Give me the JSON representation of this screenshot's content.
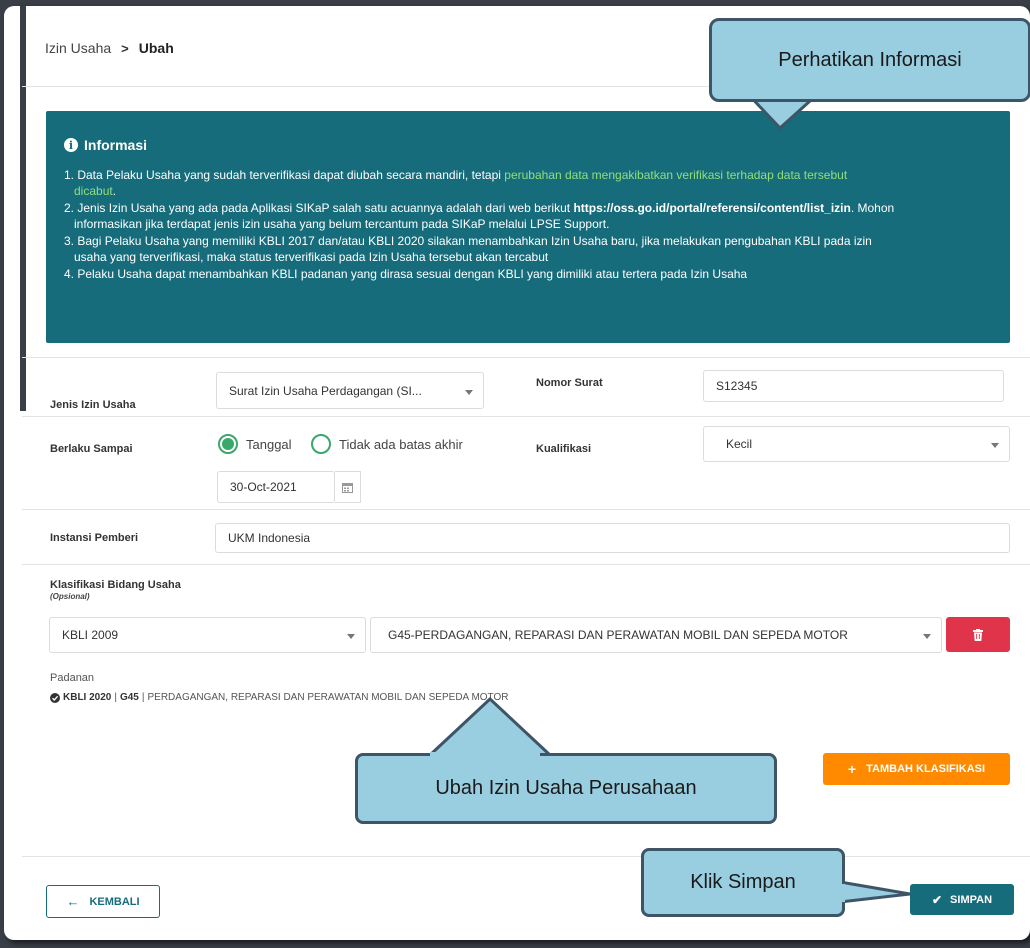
{
  "breadcrumb": {
    "parent": "Izin Usaha",
    "separator": ">",
    "current": "Ubah"
  },
  "info": {
    "title": "Informasi",
    "items": {
      "i1_a": "1. Data Pelaku Usaha yang sudah terverifikasi dapat diubah secara mandiri, tetapi ",
      "i1_hl": "perubahan data mengakibatkan verifikasi terhadap data tersebut",
      "i1_hl2": "dicabut",
      "i1_end": ".",
      "i2_a": "2. Jenis Izin Usaha yang ada pada Aplikasi SIKaP salah satu acuannya adalah dari web berikut ",
      "i2_link": "https://oss.go.id/portal/referensi/content/list_izin",
      "i2_b": ". Mohon",
      "i2_c": "informasikan jika terdapat jenis izin usaha yang belum tercantum pada SIKaP melalui LPSE Support.",
      "i3_a": "3. Bagi Pelaku Usaha yang memiliki KBLI 2017 dan/atau KBLI 2020 silakan menambahkan Izin Usaha baru, jika melakukan pengubahan KBLI pada izin",
      "i3_b": "usaha yang terverifikasi, maka status terverifikasi pada Izin Usaha tersebut akan tercabut",
      "i4": "4. Pelaku Usaha dapat menambahkan KBLI padanan yang dirasa sesuai dengan KBLI yang dimiliki atau tertera pada Izin Usaha"
    }
  },
  "form": {
    "jenis_label": "Jenis Izin Usaha",
    "jenis_value": "Surat Izin Usaha Perdagangan (SI...",
    "nomor_label": "Nomor Surat",
    "nomor_value": "S12345",
    "berlaku_label": "Berlaku Sampai",
    "radio_tanggal": "Tanggal",
    "radio_tidak": "Tidak ada batas akhir",
    "tanggal_value": "30-Oct-2021",
    "kualifikasi_label": "Kualifikasi",
    "kualifikasi_value": "Kecil",
    "instansi_label": "Instansi Pemberi",
    "instansi_value": "UKM Indonesia",
    "klasifikasi_label": "Klasifikasi Bidang Usaha",
    "klasifikasi_optional": "(Opsional)",
    "kbli_version": "KBLI 2009",
    "kbli_code": "G45-PERDAGANGAN, REPARASI DAN PERAWATAN MOBIL DAN SEPEDA MOTOR",
    "padanan_label": "Padanan",
    "padanan_version": "KBLI 2020",
    "padanan_sep1": "|",
    "padanan_code": "G45",
    "padanan_sep2": "|",
    "padanan_desc": "PERDAGANGAN, REPARASI DAN PERAWATAN MOBIL DAN SEPEDA MOTOR"
  },
  "buttons": {
    "add_label": "TAMBAH KLASIFIKASI",
    "back_label": "KEMBALI",
    "save_label": "SIMPAN"
  },
  "callouts": {
    "info": "Perhatikan Informasi",
    "edit": "Ubah Izin Usaha Perusahaan",
    "save": "Klik Simpan"
  },
  "colors": {
    "teal": "#176c7c",
    "orange": "#ff8a00",
    "red": "#e0344a",
    "green": "#39a86a",
    "callout": "#99cde0"
  }
}
